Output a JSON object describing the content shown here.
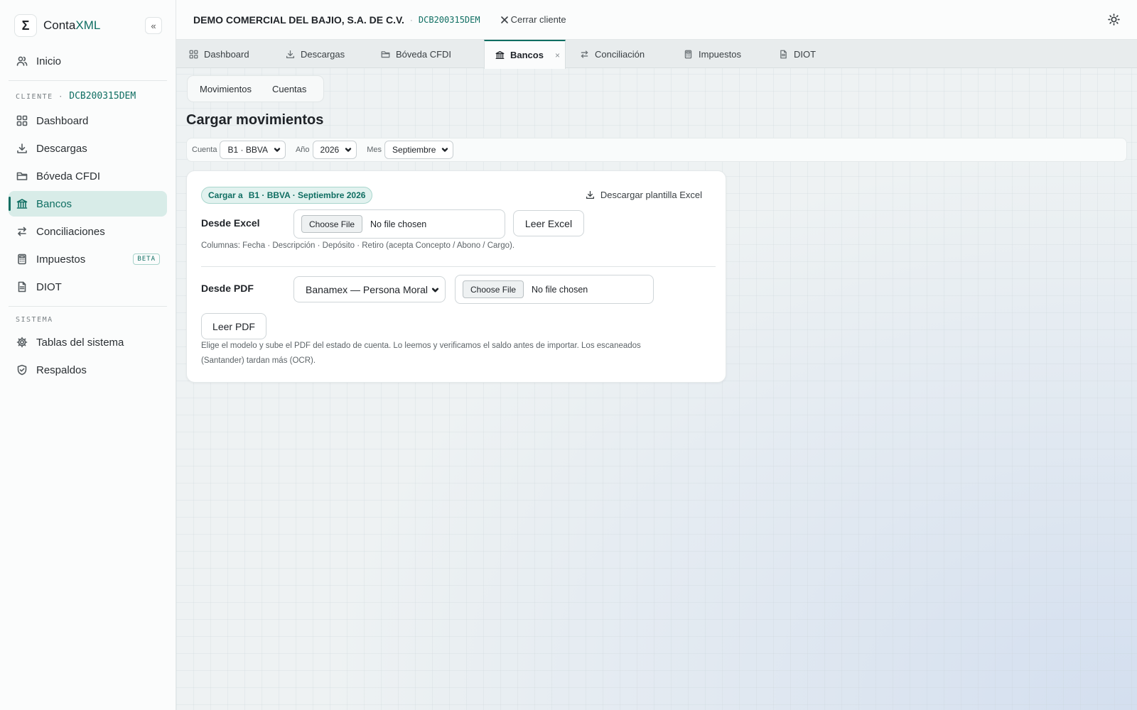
{
  "brand": {
    "logo_glyph": "Σ",
    "name_a": "Conta",
    "name_b": "XML",
    "collapse": "«"
  },
  "sidebar": {
    "inicio": "Inicio",
    "client_section": {
      "label": "CLIENTE",
      "sep": "·",
      "rfc": "DCB200315DEM"
    },
    "items": [
      {
        "label": "Dashboard",
        "icon": "dashboard-icon"
      },
      {
        "label": "Descargas",
        "icon": "download-icon"
      },
      {
        "label": "Bóveda CFDI",
        "icon": "folder-icon"
      },
      {
        "label": "Bancos",
        "icon": "bank-icon",
        "active": true
      },
      {
        "label": "Conciliaciones",
        "icon": "arrows-exchange-icon"
      },
      {
        "label": "Impuestos",
        "icon": "calculator-icon",
        "badge": "BETA"
      },
      {
        "label": "DIOT",
        "icon": "document-icon"
      }
    ],
    "system_section": {
      "label": "SISTEMA"
    },
    "system_items": [
      {
        "label": "Tablas del sistema",
        "icon": "gear-icon"
      },
      {
        "label": "Respaldos",
        "icon": "shield-check-icon"
      }
    ]
  },
  "topbar": {
    "client_name": "DEMO COMERCIAL DEL BAJIO, S.A. DE C.V.",
    "sep": "·",
    "client_rfc": "DCB200315DEM",
    "close_client": "Cerrar cliente"
  },
  "tabs": [
    {
      "label": "Dashboard",
      "icon": "dashboard-icon"
    },
    {
      "label": "Descargas",
      "icon": "download-icon"
    },
    {
      "label": "Bóveda CFDI",
      "icon": "folder-icon"
    },
    {
      "label": "Bancos",
      "icon": "bank-icon",
      "active": true,
      "close": "×"
    },
    {
      "label": "Conciliación",
      "icon": "arrows-exchange-icon"
    },
    {
      "label": "Impuestos",
      "icon": "calculator-icon"
    },
    {
      "label": "DIOT",
      "icon": "document-icon"
    }
  ],
  "subtabs": [
    "Movimientos",
    "Cuentas"
  ],
  "page_title": "Cargar movimientos",
  "filters": {
    "cuenta_label": "Cuenta",
    "cuenta_value": "B1 · BBVA",
    "anio_label": "Año",
    "anio_value": "2026",
    "mes_label": "Mes",
    "mes_value": "Septiembre"
  },
  "card": {
    "target_lead": "Cargar a",
    "target_value": "B1 · BBVA · Septiembre 2026",
    "download_template": "Descargar plantilla Excel",
    "excel": {
      "label": "Desde Excel",
      "choose": "Choose File",
      "no_file": "No file chosen",
      "read_button": "Leer Excel",
      "hint": "Columnas: Fecha · Descripción · Depósito · Retiro (acepta Concepto / Abono / Cargo)."
    },
    "pdf": {
      "label": "Desde PDF",
      "model_value": "Banamex — Persona Moral",
      "choose": "Choose File",
      "no_file": "No file chosen",
      "read_button": "Leer PDF",
      "hint_line1": "Elige el modelo y sube el PDF del estado de cuenta. Lo leemos y verificamos el saldo antes de importar. Los escaneados",
      "hint_line2": "(Santander) tardan más (OCR)."
    }
  },
  "colors": {
    "accent": "#0f6e62",
    "accent_bg": "#d8ece8"
  }
}
